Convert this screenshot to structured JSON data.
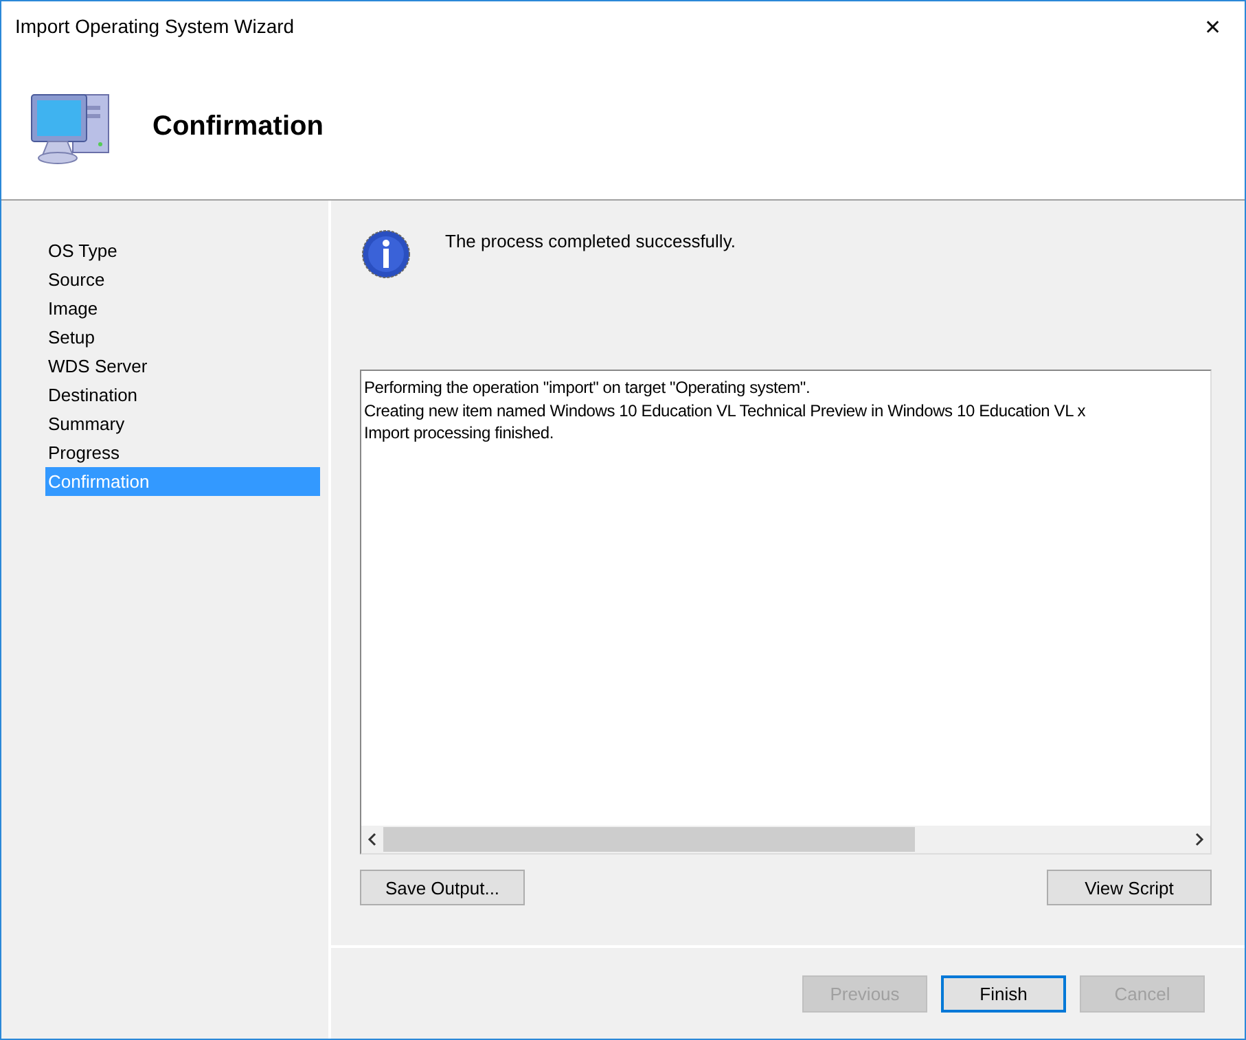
{
  "window": {
    "title": "Import Operating System Wizard",
    "close": "✕"
  },
  "header": {
    "title": "Confirmation"
  },
  "sidebar": {
    "items": [
      {
        "label": "OS Type",
        "selected": false
      },
      {
        "label": "Source",
        "selected": false
      },
      {
        "label": "Image",
        "selected": false
      },
      {
        "label": "Setup",
        "selected": false
      },
      {
        "label": "WDS Server",
        "selected": false
      },
      {
        "label": "Destination",
        "selected": false
      },
      {
        "label": "Summary",
        "selected": false
      },
      {
        "label": "Progress",
        "selected": false
      },
      {
        "label": "Confirmation",
        "selected": true
      }
    ]
  },
  "message": "The process completed successfully.",
  "output": {
    "lines": [
      "Performing the operation \"import\" on target \"Operating system\".",
      "Creating new item named Windows 10 Education VL Technical Preview in Windows 10 Education VL x",
      "Import processing finished."
    ]
  },
  "output_buttons": [
    {
      "label": "Save Output..."
    },
    {
      "label": "View Script"
    }
  ],
  "nav_buttons": [
    {
      "label": "Previous",
      "disabled": true,
      "default": false
    },
    {
      "label": "Finish",
      "disabled": false,
      "default": true
    },
    {
      "label": "Cancel",
      "disabled": true,
      "default": false
    }
  ]
}
